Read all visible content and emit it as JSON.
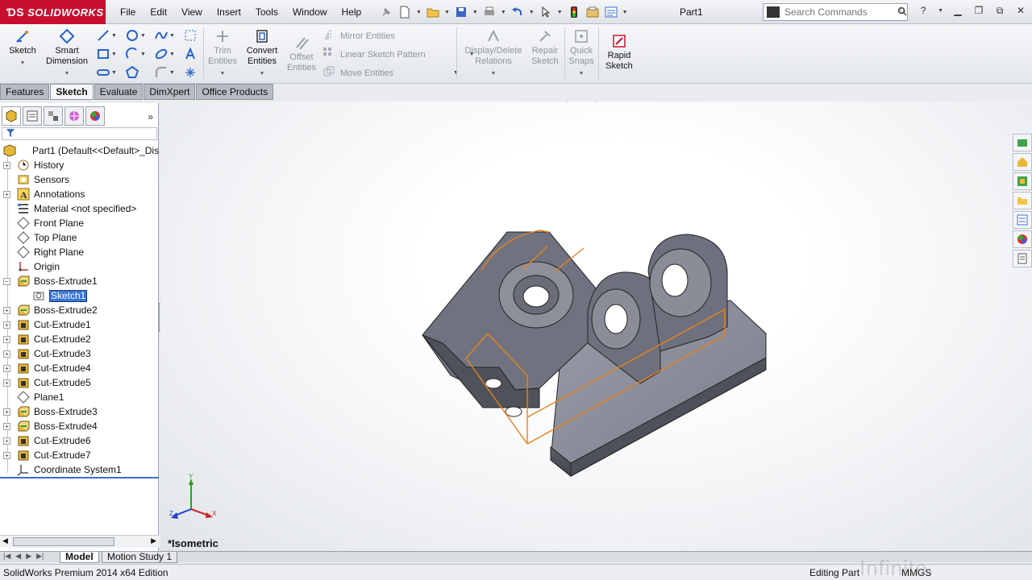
{
  "app": {
    "brand": "SOLIDWORKS",
    "doc_title": "Part1"
  },
  "menu": [
    "File",
    "Edit",
    "View",
    "Insert",
    "Tools",
    "Window",
    "Help"
  ],
  "search": {
    "placeholder": "Search Commands"
  },
  "commands": {
    "sketch": "Sketch",
    "smart_dimension_1": "Smart",
    "smart_dimension_2": "Dimension",
    "trim_1": "Trim",
    "trim_2": "Entities",
    "convert_1": "Convert",
    "convert_2": "Entities",
    "offset_1": "Offset",
    "offset_2": "Entities",
    "mirror": "Mirror Entities",
    "linear_pattern": "Linear Sketch Pattern",
    "move": "Move Entities",
    "display_delete_1": "Display/Delete",
    "display_delete_2": "Relations",
    "repair_1": "Repair",
    "repair_2": "Sketch",
    "quick_snaps_1": "Quick",
    "quick_snaps_2": "Snaps",
    "rapid_1": "Rapid",
    "rapid_2": "Sketch"
  },
  "cm_tabs": [
    "Features",
    "Sketch",
    "Evaluate",
    "DimXpert",
    "Office Products"
  ],
  "tree": {
    "root": "Part1  (Default<<Default>_Dis",
    "items": [
      "History",
      "Sensors",
      "Annotations",
      "Material <not specified>",
      "Front Plane",
      "Top Plane",
      "Right Plane",
      "Origin",
      "Boss-Extrude1",
      "Sketch1",
      "Boss-Extrude2",
      "Cut-Extrude1",
      "Cut-Extrude2",
      "Cut-Extrude3",
      "Cut-Extrude4",
      "Cut-Extrude5",
      "Plane1",
      "Boss-Extrude3",
      "Boss-Extrude4",
      "Cut-Extrude6",
      "Cut-Extrude7",
      "Coordinate System1"
    ]
  },
  "viewport": {
    "view_label": "*Isometric"
  },
  "bottom_tabs": [
    "Model",
    "Motion Study 1"
  ],
  "status": {
    "edition": "SolidWorks Premium 2014 x64 Edition",
    "mode": "Editing Part",
    "units": "MMGS"
  },
  "colors": {
    "brand_red": "#c8102e",
    "selection_blue": "#3875d7",
    "sketch_orange": "#e8821e",
    "model_gray": "#6e7180"
  },
  "watermark": "Infinite Skills.com"
}
